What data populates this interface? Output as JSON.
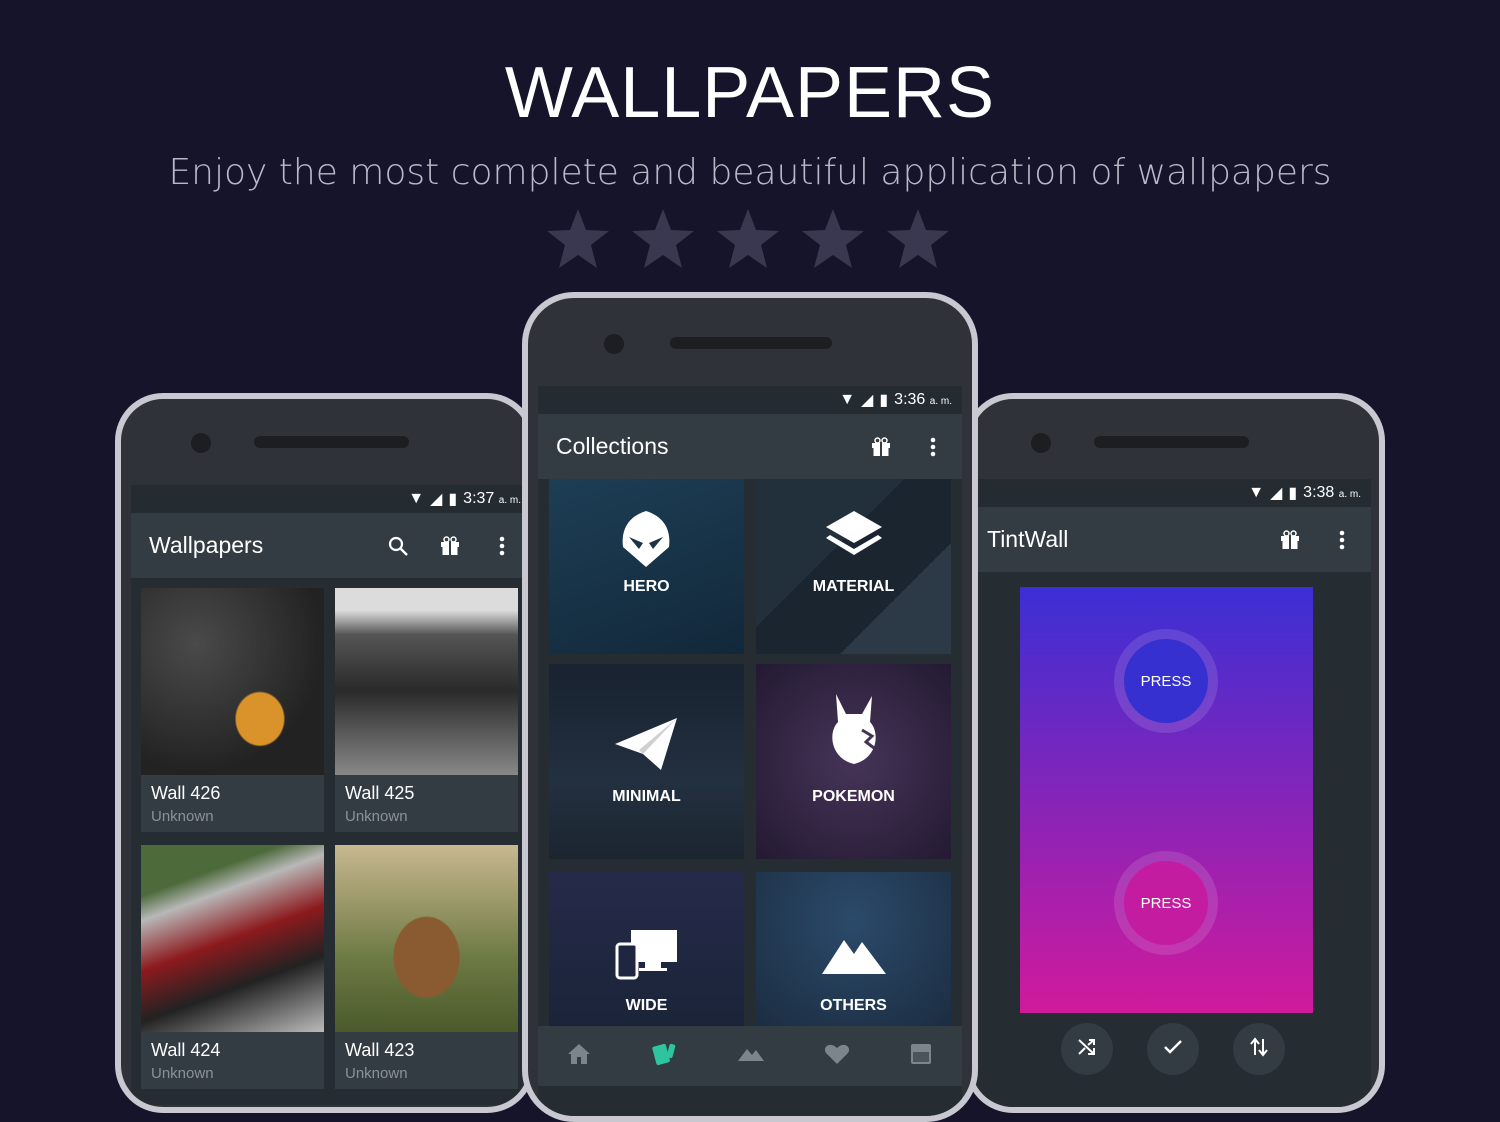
{
  "promo": {
    "headline": "WALLPAPERS",
    "subtitle": "Enjoy the most complete and beautiful application of wallpapers",
    "rating": {
      "stars": 5,
      "color": "#3a3850"
    }
  },
  "left_phone": {
    "status_time": "3:37",
    "status_suffix": "a. m.",
    "app_title": "Wallpapers",
    "actions": [
      "search-icon",
      "gift-icon",
      "more-vert-icon"
    ],
    "walls": [
      {
        "title": "Wall 426",
        "author": "Unknown"
      },
      {
        "title": "Wall 425",
        "author": "Unknown"
      },
      {
        "title": "Wall 424",
        "author": "Unknown"
      },
      {
        "title": "Wall 423",
        "author": "Unknown"
      }
    ]
  },
  "center_phone": {
    "status_time": "3:36",
    "status_suffix": "a. m.",
    "app_title": "Collections",
    "actions": [
      "gift-icon",
      "more-vert-icon"
    ],
    "collections": [
      {
        "label": "HERO",
        "icon": "mask-icon"
      },
      {
        "label": "MATERIAL",
        "icon": "layers-icon"
      },
      {
        "label": "MINIMAL",
        "icon": "paper-plane-icon"
      },
      {
        "label": "POKEMON",
        "icon": "pikachu-icon"
      },
      {
        "label": "WIDE",
        "icon": "devices-icon"
      },
      {
        "label": "OTHERS",
        "icon": "mountain-icon"
      }
    ],
    "bottom_nav": [
      {
        "name": "home-icon",
        "active": false
      },
      {
        "name": "collections-icon",
        "active": true
      },
      {
        "name": "wallpapers-icon",
        "active": false
      },
      {
        "name": "favorites-icon",
        "active": false
      },
      {
        "name": "muzei-icon",
        "active": false
      }
    ],
    "accent": "#2ec4a0"
  },
  "right_phone": {
    "status_time": "3:38",
    "status_suffix": "a. m.",
    "app_title": "TintWall",
    "actions": [
      "gift-icon",
      "more-vert-icon"
    ],
    "top_button": "PRESS",
    "bottom_button": "PRESS",
    "gradient_top": "#3b2fd4",
    "gradient_bottom": "#d11a9c",
    "fabs": [
      "shuffle-icon",
      "check-icon",
      "swap-vert-icon"
    ]
  }
}
